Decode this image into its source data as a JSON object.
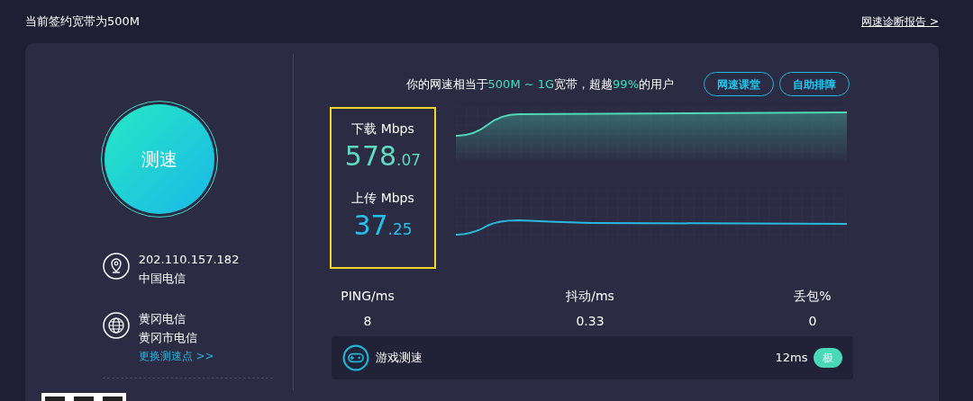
{
  "header": {
    "plan": "当前签约宽带为500M",
    "report_link": "网速诊断报告 >"
  },
  "speed_button": {
    "label": "测速"
  },
  "info": [
    {
      "kind": "location",
      "lines": [
        "202.110.157.182",
        "中国电信"
      ]
    },
    {
      "kind": "server",
      "lines": [
        "黄冈电信",
        "黄冈市电信"
      ],
      "link": "更换测速点 >>"
    }
  ],
  "summary": {
    "before": "你的网速相当于",
    "range": "500M ~ 1G",
    "middle": "宽带，超越",
    "percent": "99%",
    "after": "的用户"
  },
  "actions": [
    "网速课堂",
    "自助排障"
  ],
  "results": [
    {
      "kind": "download",
      "label": "下载 Mbps",
      "integer": "578",
      "decimal": ".07"
    },
    {
      "kind": "upload",
      "label": "上传 Mbps",
      "integer": "37",
      "decimal": ".25"
    }
  ],
  "stats": [
    {
      "label": "PING/ms",
      "value": "8"
    },
    {
      "label": "抖动/ms",
      "value": "0.33"
    },
    {
      "label": "丢包%",
      "value": "0"
    }
  ],
  "game": {
    "label": "游戏测速",
    "latency": "12ms",
    "rating": "极"
  }
}
